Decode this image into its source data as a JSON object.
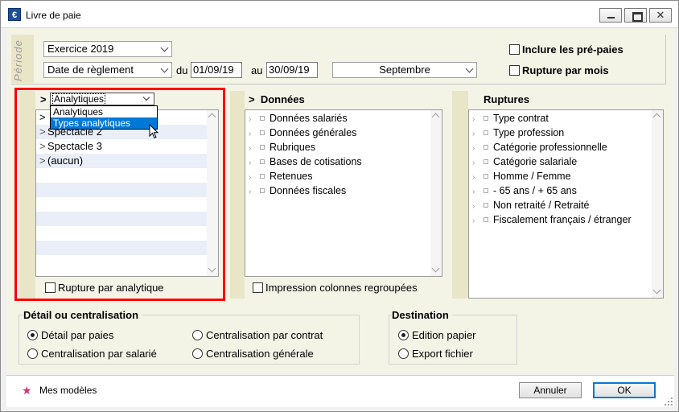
{
  "window": {
    "title": "Livre de paie",
    "icon": "euro-app-icon",
    "close_glyph": "✕"
  },
  "periode": {
    "label": "Période",
    "exercice": "Exercice 2019",
    "date_mode": "Date de règlement",
    "du_label": "du",
    "date_from": "01/09/19",
    "au_label": "au",
    "date_to": "30/09/19",
    "month": "Septembre",
    "inclure_pre_paies": "Inclure les pré-paies",
    "rupture_par_mois": "Rupture par mois"
  },
  "analytique_panel": {
    "chevron": ">",
    "selected": "Analytiques",
    "dropdown_options": [
      "Analytiques",
      "Types analytiques"
    ],
    "items": [
      ">",
      "Spectacle 2",
      "Spectacle 3",
      "(aucun)"
    ],
    "rupture_label": "Rupture par analytique"
  },
  "donnees_panel": {
    "title": "Données",
    "items": [
      "Données salariés",
      "Données générales",
      "Rubriques",
      "Bases de cotisations",
      "Retenues",
      "Données fiscales"
    ],
    "impression_label": "Impression colonnes regroupées"
  },
  "ruptures_panel": {
    "title": "Ruptures",
    "items": [
      "Type contrat",
      "Type profession",
      "Catégorie professionnelle",
      "Catégorie salariale",
      "Homme / Femme",
      "- 65 ans / + 65 ans",
      "Non retraité / Retraité",
      "Fiscalement français / étranger"
    ]
  },
  "detail_group": {
    "title": "Détail ou centralisation",
    "options": [
      "Détail par paies",
      "Centralisation par contrat",
      "Centralisation par salarié",
      "Centralisation générale"
    ],
    "selected": "Détail par paies"
  },
  "destination_group": {
    "title": "Destination",
    "options": [
      "Edition papier",
      "Export fichier"
    ],
    "selected": "Edition papier"
  },
  "footer": {
    "models_label": "Mes modèles",
    "cancel": "Annuler",
    "ok": "OK",
    "star_glyph": "★"
  },
  "colors": {
    "accent": "#0078d7",
    "highlight_frame": "#ff0000",
    "band": "#e9e6c8",
    "star": "#d6336c"
  }
}
